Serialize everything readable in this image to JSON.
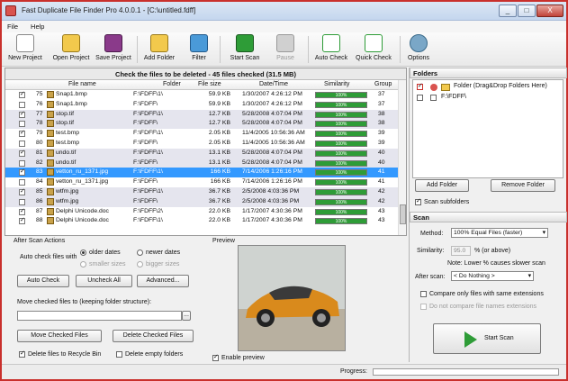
{
  "window": {
    "title": "Fast Duplicate File Finder Pro 4.0.0.1 - [C:\\untitled.fdff]",
    "min": "_",
    "max": "□",
    "close": "X"
  },
  "menu": [
    "File",
    "Help"
  ],
  "toolbar": {
    "new_project": "New Project",
    "open_project": "Open Project",
    "save_project": "Save Project",
    "add_folder": "Add Folder",
    "filter": "Filter",
    "start_scan": "Start Scan",
    "pause": "Pause",
    "auto_check": "Auto Check",
    "quick_check": "Quick Check",
    "options": "Options"
  },
  "results": {
    "header": "Check the files to be deleted - 45 files checked (31.5 MB)",
    "columns": [
      "File name",
      "Folder",
      "File size",
      "Date/Time",
      "Similarity",
      "Group"
    ],
    "rows": [
      {
        "checked": true,
        "num": "75",
        "name": "Snap1.bmp",
        "folder": "F:\\FDFF\\1\\",
        "size": "59.9 KB",
        "date": "1/30/2007 4:26:12 PM",
        "sim": "100%",
        "group": "37",
        "alt": false,
        "sel": false
      },
      {
        "checked": false,
        "num": "76",
        "name": "Snap1.bmp",
        "folder": "F:\\FDFF\\",
        "size": "59.9 KB",
        "date": "1/30/2007 4:26:12 PM",
        "sim": "100%",
        "group": "37",
        "alt": false,
        "sel": false
      },
      {
        "checked": true,
        "num": "77",
        "name": "stop.tif",
        "folder": "F:\\FDFF\\1\\",
        "size": "12.7 KB",
        "date": "5/28/2008 4:07:04 PM",
        "sim": "100%",
        "group": "38",
        "alt": true,
        "sel": false
      },
      {
        "checked": false,
        "num": "78",
        "name": "stop.tif",
        "folder": "F:\\FDFF\\",
        "size": "12.7 KB",
        "date": "5/28/2008 4:07:04 PM",
        "sim": "100%",
        "group": "38",
        "alt": true,
        "sel": false
      },
      {
        "checked": true,
        "num": "79",
        "name": "test.bmp",
        "folder": "F:\\FDFF\\1\\",
        "size": "2.05 KB",
        "date": "11/4/2005 10:56:36 AM",
        "sim": "100%",
        "group": "39",
        "alt": false,
        "sel": false
      },
      {
        "checked": false,
        "num": "80",
        "name": "test.bmp",
        "folder": "F:\\FDFF\\",
        "size": "2.05 KB",
        "date": "11/4/2005 10:56:36 AM",
        "sim": "100%",
        "group": "39",
        "alt": false,
        "sel": false
      },
      {
        "checked": true,
        "num": "81",
        "name": "undo.tif",
        "folder": "F:\\FDFF\\1\\",
        "size": "13.1 KB",
        "date": "5/28/2008 4:07:04 PM",
        "sim": "100%",
        "group": "40",
        "alt": true,
        "sel": false
      },
      {
        "checked": false,
        "num": "82",
        "name": "undo.tif",
        "folder": "F:\\FDFF\\",
        "size": "13.1 KB",
        "date": "5/28/2008 4:07:04 PM",
        "sim": "100%",
        "group": "40",
        "alt": true,
        "sel": false
      },
      {
        "checked": true,
        "num": "83",
        "name": "vetton_ru_1371.jpg",
        "folder": "F:\\FDFF\\1\\",
        "size": "166 KB",
        "date": "7/14/2006 1:26:16 PM",
        "sim": "100%",
        "group": "41",
        "alt": false,
        "sel": true
      },
      {
        "checked": false,
        "num": "84",
        "name": "vetton_ru_1371.jpg",
        "folder": "F:\\FDFF\\",
        "size": "166 KB",
        "date": "7/14/2006 1:26:16 PM",
        "sim": "100%",
        "group": "41",
        "alt": false,
        "sel": false
      },
      {
        "checked": true,
        "num": "85",
        "name": "wtfm.jpg",
        "folder": "F:\\FDFF\\1\\",
        "size": "36.7 KB",
        "date": "2/5/2008 4:03:36 PM",
        "sim": "100%",
        "group": "42",
        "alt": true,
        "sel": false
      },
      {
        "checked": false,
        "num": "86",
        "name": "wtfm.jpg",
        "folder": "F:\\FDFF\\",
        "size": "36.7 KB",
        "date": "2/5/2008 4:03:36 PM",
        "sim": "100%",
        "group": "42",
        "alt": true,
        "sel": false
      },
      {
        "checked": true,
        "num": "87",
        "name": "Delphi Unicode.doc",
        "folder": "F:\\FDFF\\2\\",
        "size": "22.0 KB",
        "date": "1/17/2007 4:30:36 PM",
        "sim": "100%",
        "group": "43",
        "alt": false,
        "sel": false
      },
      {
        "checked": true,
        "num": "88",
        "name": "Delphi Unicode.doc",
        "folder": "F:\\FDFF\\1\\",
        "size": "22.0 KB",
        "date": "1/17/2007 4:30:36 PM",
        "sim": "100%",
        "group": "43",
        "alt": false,
        "sel": false
      }
    ]
  },
  "after_scan": {
    "title": "After Scan Actions",
    "auto_check_label": "Auto check files with",
    "opt_older": "older dates",
    "opt_newer": "newer dates",
    "opt_smaller": "smaller sizes",
    "opt_bigger": "bigger sizes",
    "auto_check_btn": "Auto Check",
    "uncheck_all_btn": "Uncheck All",
    "advanced_btn": "Advanced...",
    "move_label": "Move checked files to (keeping folder structure):",
    "move_value": "",
    "browse": "...",
    "move_btn": "Move Checked Files",
    "delete_btn": "Delete Checked Files",
    "recycle_label": "Delete files to Recycle Bin",
    "empty_folders_label": "Delete empty folders"
  },
  "preview": {
    "title": "Preview",
    "enable_label": "Enable preview"
  },
  "folders": {
    "title": "Folders",
    "items": [
      {
        "label": "Folder (Drag&Drop Folders Here)",
        "checked": true
      },
      {
        "label": "F:\\FDFF\\",
        "checked": false
      }
    ],
    "add_btn": "Add Folder",
    "remove_btn": "Remove Folder",
    "scan_sub": "Scan subfolders"
  },
  "scan": {
    "title": "Scan",
    "method_label": "Method:",
    "method_value": "100% Equal Files (faster)",
    "similarity_label": "Similarity:",
    "similarity_value": "95.0",
    "similarity_suffix": "% (or above)",
    "note": "Note: Lower % causes slower scan",
    "after_scan_label": "After scan:",
    "after_scan_value": "< Do Nothing >",
    "compare_ext": "Compare only files with same extensions",
    "no_compare_names": "Do not compare file names extensions",
    "start_btn": "Start Scan"
  },
  "status": {
    "progress_label": "Progress:",
    "progress": 0
  }
}
